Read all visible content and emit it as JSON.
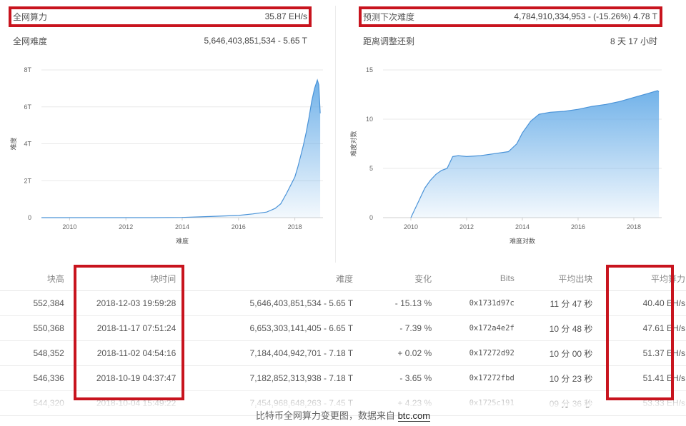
{
  "left_panel": {
    "hashrate_label": "全网算力",
    "hashrate_value": "35.87 EH/s",
    "difficulty_label": "全网难度",
    "difficulty_value": "5,646,403,851,534 - 5.65 T"
  },
  "right_panel": {
    "next_diff_label": "预测下次难度",
    "next_diff_value": "4,784,910,334,953 - (-15.26%) 4.78 T",
    "remaining_label": "距离调整还剩",
    "remaining_value": "8 天 17 小时"
  },
  "charts": [
    {
      "type": "area",
      "ylabel": "难度",
      "xlabel": "难度",
      "yticks": [
        "0",
        "2T",
        "4T",
        "6T",
        "8T"
      ],
      "xticks": [
        "2010",
        "2012",
        "2014",
        "2016",
        "2018"
      ],
      "x": [
        2009.0,
        2013.0,
        2014.0,
        2015.0,
        2016.0,
        2016.5,
        2017.0,
        2017.3,
        2017.5,
        2017.7,
        2017.9,
        2018.0,
        2018.1,
        2018.2,
        2018.3,
        2018.4,
        2018.5,
        2018.6,
        2018.7,
        2018.8,
        2018.85,
        2018.9
      ],
      "y": [
        0,
        0.001,
        0.01,
        0.06,
        0.12,
        0.2,
        0.3,
        0.5,
        0.75,
        1.3,
        1.9,
        2.2,
        2.7,
        3.3,
        3.9,
        4.6,
        5.4,
        6.3,
        7.0,
        7.45,
        7.2,
        5.65
      ],
      "ylim": [
        0,
        8
      ],
      "xlim": [
        2009.0,
        2019.0
      ],
      "grid": true,
      "color": "#6aaee8"
    },
    {
      "type": "area",
      "ylabel": "难度对数",
      "xlabel": "难度对数",
      "yticks": [
        "0",
        "5",
        "10",
        "15"
      ],
      "xticks": [
        "2010",
        "2012",
        "2014",
        "2016",
        "2018"
      ],
      "x": [
        2010.0,
        2010.1,
        2010.3,
        2010.5,
        2010.7,
        2010.9,
        2011.1,
        2011.3,
        2011.5,
        2011.7,
        2012.0,
        2012.5,
        2013.0,
        2013.5,
        2013.8,
        2014.0,
        2014.3,
        2014.6,
        2015.0,
        2015.5,
        2016.0,
        2016.5,
        2017.0,
        2017.5,
        2018.0,
        2018.5,
        2018.85,
        2018.9
      ],
      "y": [
        0,
        0.6,
        1.8,
        3.0,
        3.8,
        4.4,
        4.8,
        5.0,
        6.2,
        6.3,
        6.2,
        6.3,
        6.5,
        6.7,
        7.5,
        8.6,
        9.8,
        10.5,
        10.7,
        10.8,
        11.0,
        11.3,
        11.5,
        11.8,
        12.2,
        12.6,
        12.9,
        12.8
      ],
      "ylim": [
        0,
        15
      ],
      "xlim": [
        2009.0,
        2019.0
      ],
      "grid": true,
      "color": "#6aaee8"
    }
  ],
  "table": {
    "headers": [
      "块高",
      "块时间",
      "难度",
      "变化",
      "Bits",
      "平均出块",
      "平均算力"
    ],
    "rows": [
      {
        "height": "552,384",
        "time": "2018-12-03 19:59:28",
        "difficulty": "5,646,403,851,534 - 5.65 T",
        "change": "- 15.13 %",
        "dir": "neg",
        "bits": "0x1731d97c",
        "avg_block": "11 分 47 秒",
        "avg_hash": "40.40 EH/s"
      },
      {
        "height": "550,368",
        "time": "2018-11-17 07:51:24",
        "difficulty": "6,653,303,141,405 - 6.65 T",
        "change": "- 7.39 %",
        "dir": "neg",
        "bits": "0x172a4e2f",
        "avg_block": "10 分 48 秒",
        "avg_hash": "47.61 EH/s"
      },
      {
        "height": "548,352",
        "time": "2018-11-02 04:54:16",
        "difficulty": "7,184,404,942,701 - 7.18 T",
        "change": "+ 0.02 %",
        "dir": "pos",
        "bits": "0x17272d92",
        "avg_block": "10 分 00 秒",
        "avg_hash": "51.37 EH/s"
      },
      {
        "height": "546,336",
        "time": "2018-10-19 04:37:47",
        "difficulty": "7,182,852,313,938 - 7.18 T",
        "change": "- 3.65 %",
        "dir": "neg",
        "bits": "0x17272fbd",
        "avg_block": "10 分 23 秒",
        "avg_hash": "51.41 EH/s"
      },
      {
        "height": "544,320",
        "time": "2018-10-04 15:49:22",
        "difficulty": "7,454,968,648,263 - 7.45 T",
        "change": "+ 4.23 %",
        "dir": "pos",
        "bits": "0x1725c191",
        "avg_block": "09 分 36 秒",
        "avg_hash": "53.33 EH/s"
      }
    ]
  },
  "caption": {
    "text": "比特币全网算力变更图，数据来自",
    "source": "btc.com"
  },
  "colors": {
    "highlight": "#c8141e",
    "link": "#2a6bb0",
    "negative": "#e0333a",
    "positive": "#2e9e3e",
    "area": "#6aaee8"
  }
}
